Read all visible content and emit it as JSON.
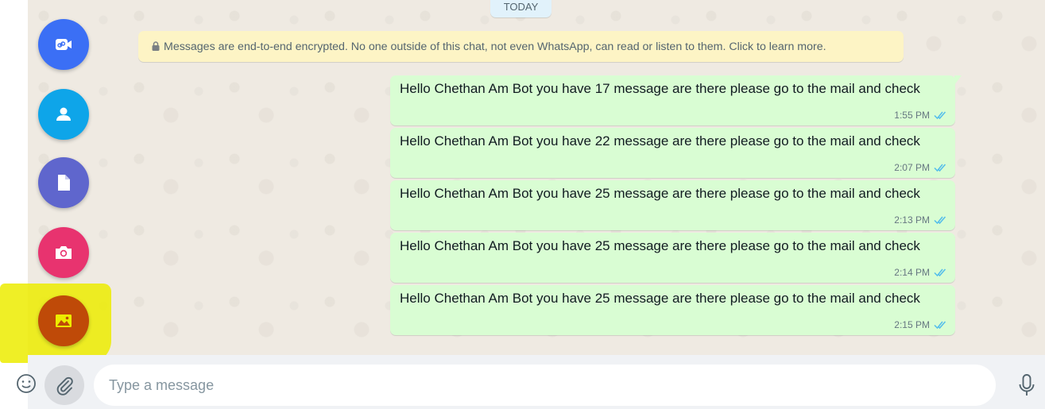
{
  "chat": {
    "date_divider": "TODAY",
    "encryption_notice": "Messages are end-to-end encrypted. No one outside of this chat, not even WhatsApp, can read or listen to them. Click to learn more.",
    "messages": [
      {
        "text": "Hello Chethan Am Bot you have 17 message are there please go to the mail and check",
        "time": "1:55 PM",
        "status": "read"
      },
      {
        "text": "Hello Chethan Am Bot you have 22 message are there please go to the mail and check",
        "time": "2:07 PM",
        "status": "read"
      },
      {
        "text": "Hello Chethan Am Bot you have 25 message are there please go to the mail and check",
        "time": "2:13 PM",
        "status": "read"
      },
      {
        "text": "Hello Chethan Am Bot you have 25 message are there please go to the mail and check",
        "time": "2:14 PM",
        "status": "read"
      },
      {
        "text": "Hello Chethan Am Bot you have 25 message are there please go to the mail and check",
        "time": "2:15 PM",
        "status": "read"
      }
    ]
  },
  "attach_menu": {
    "items": [
      {
        "icon": "link-video-icon",
        "color": "#3b6ff5"
      },
      {
        "icon": "contact-icon",
        "color": "#0ea5e9"
      },
      {
        "icon": "document-icon",
        "color": "#5f66cd"
      },
      {
        "icon": "camera-icon",
        "color": "#e8336f"
      },
      {
        "icon": "gallery-icon",
        "color": "#bf4a08"
      }
    ]
  },
  "composer": {
    "placeholder": "Type a message",
    "emoji_icon": "emoji-icon",
    "attach_icon": "paperclip-icon",
    "mic_icon": "microphone-icon"
  },
  "colors": {
    "outgoing_bubble": "#d9fdd3",
    "read_tick": "#53bdeb",
    "highlight": "#ecec00",
    "chat_background": "#efeae2"
  }
}
